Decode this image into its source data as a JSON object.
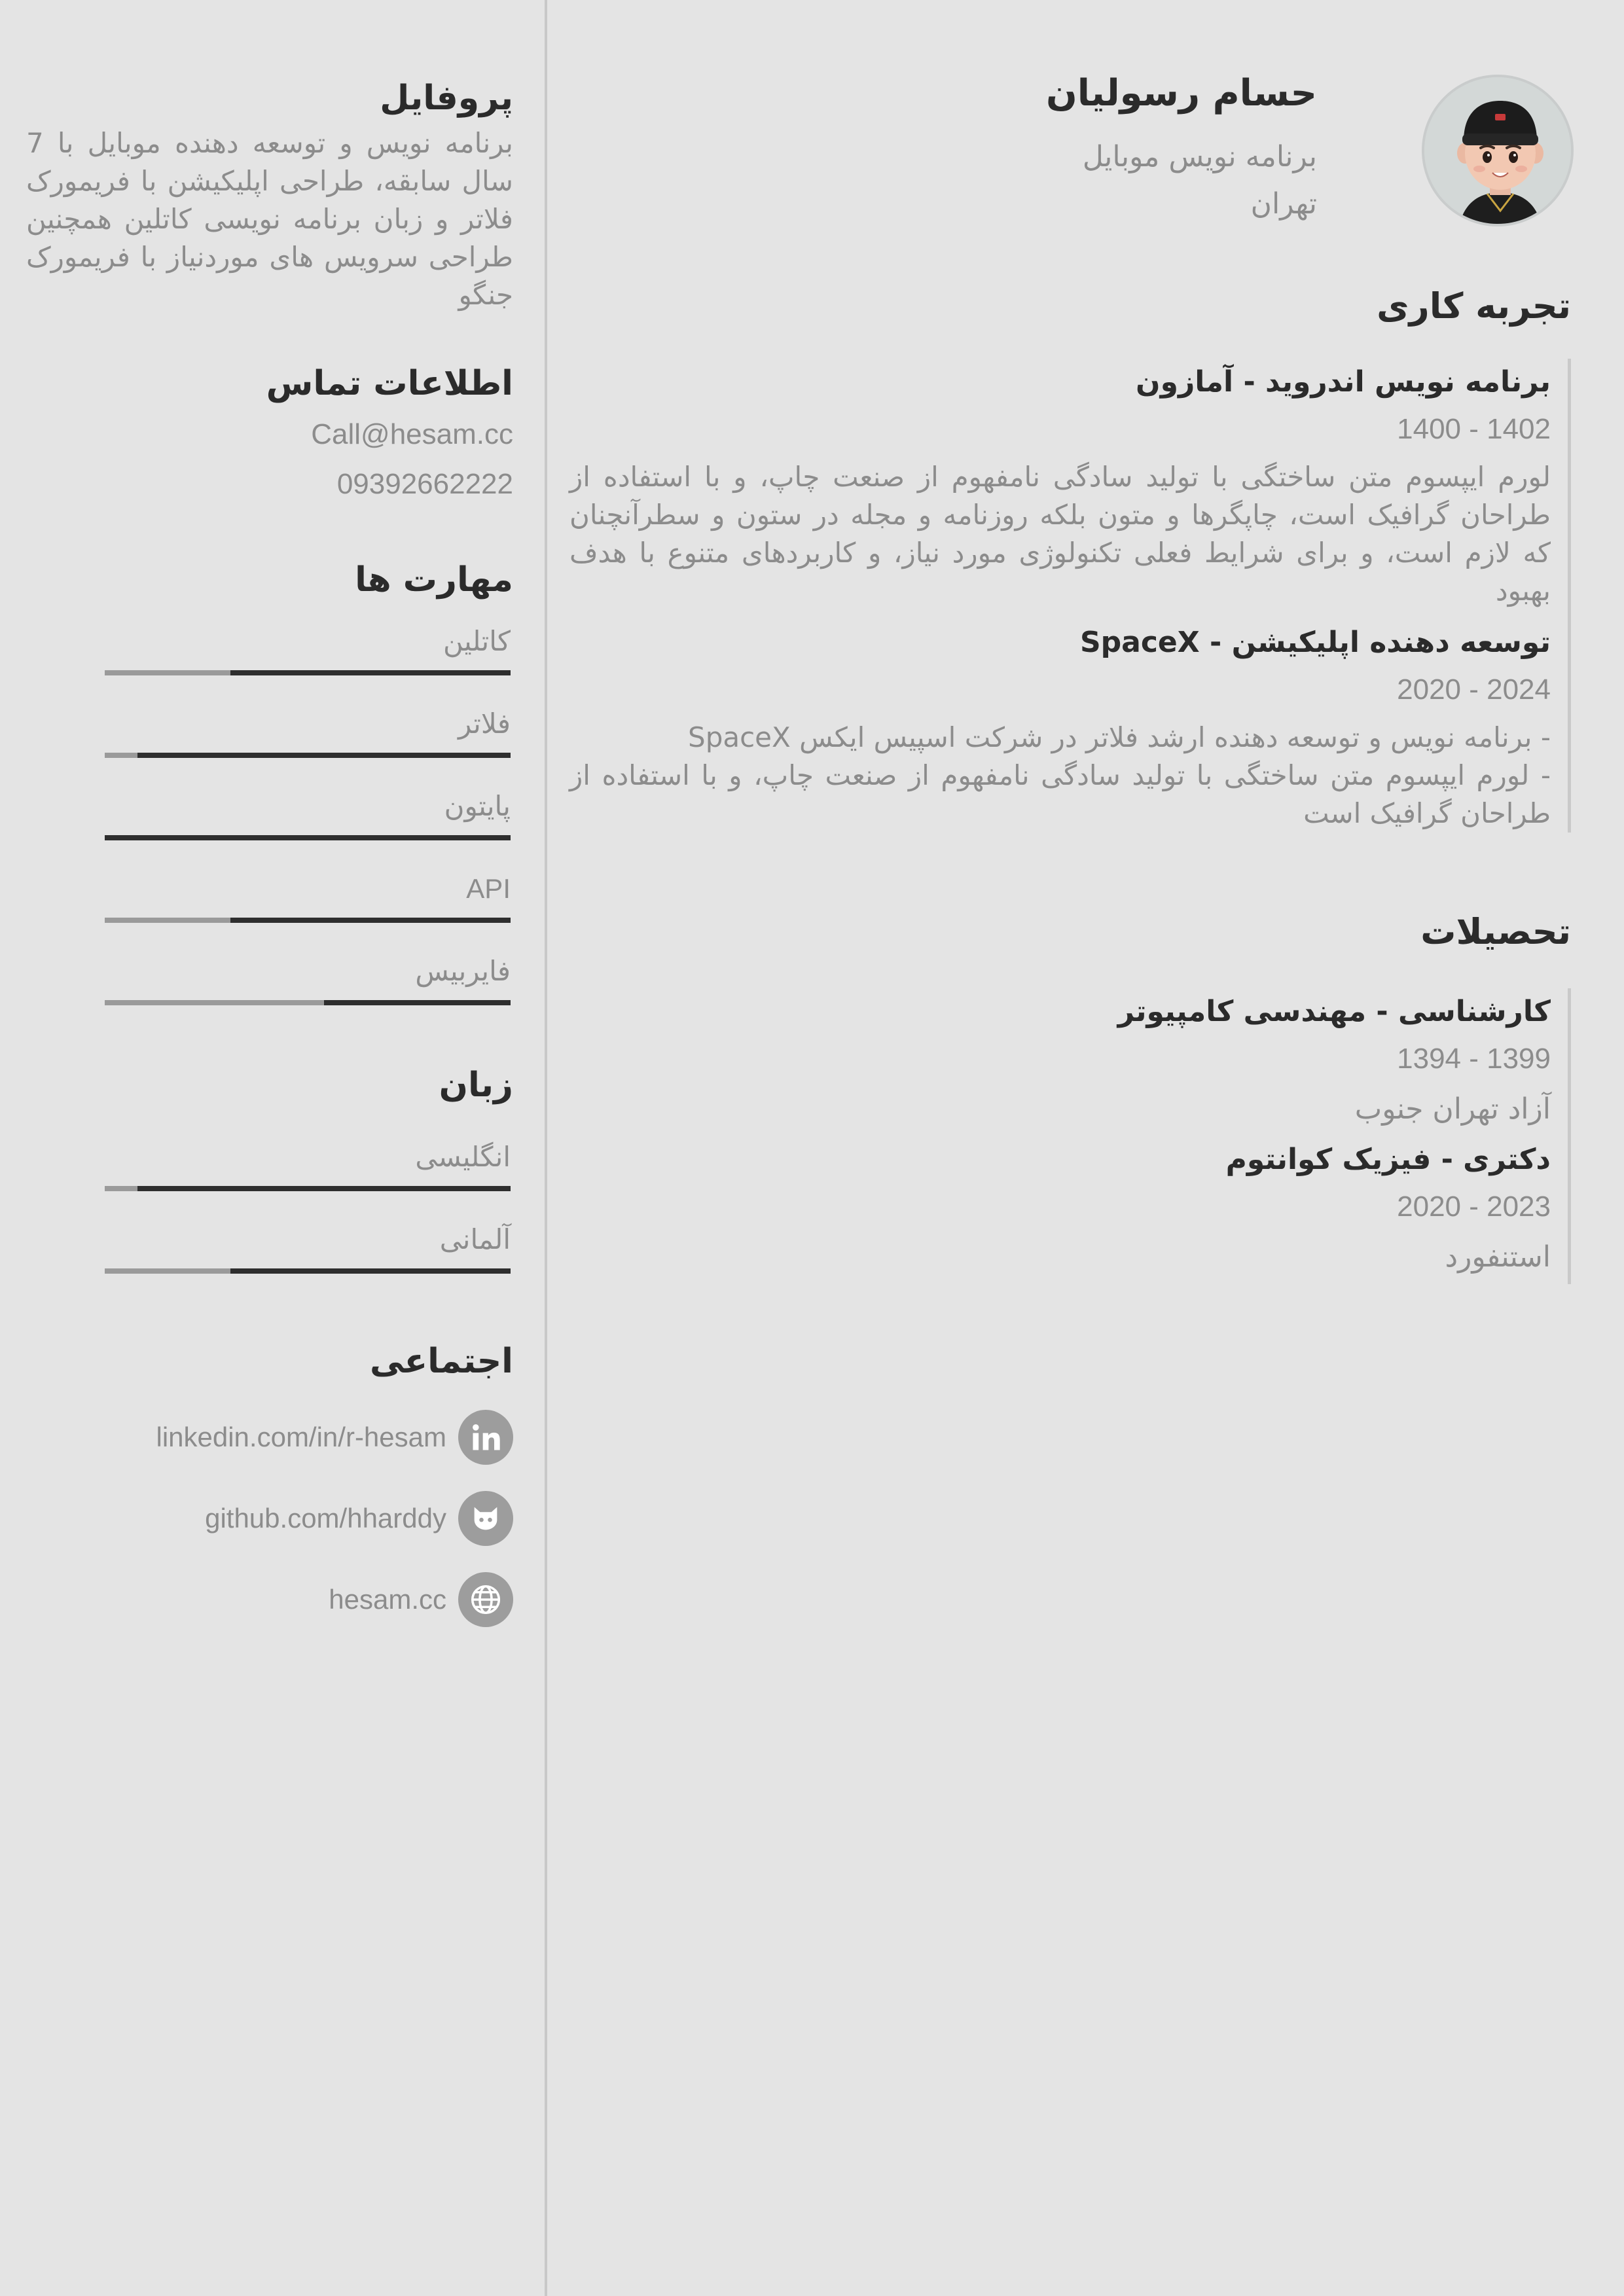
{
  "header": {
    "name": "حسام رسولیان",
    "job_title": "برنامه نویس موبایل",
    "city": "تهران"
  },
  "profile": {
    "heading": "پروفایل",
    "text": "برنامه نویس و توسعه دهنده موبایل با 7 سال سابقه، طراحی اپلیکیشن با فریمورک فلاتر و زبان برنامه نویسی کاتلین همچنین طراحی سرویس های موردنیاز با فریمورک جنگو"
  },
  "contact": {
    "heading": "اطلاعات تماس",
    "email": "Call@hesam.cc",
    "phone": "09392662222"
  },
  "skills": {
    "heading": "مهارت ها",
    "items": [
      {
        "label": "کاتلین",
        "level": 0.69
      },
      {
        "label": "فلاتر",
        "level": 0.92
      },
      {
        "label": "پایتون",
        "level": 1.0
      },
      {
        "label": "API",
        "level": 0.69
      },
      {
        "label": "فایربیس",
        "level": 0.46
      }
    ]
  },
  "languages": {
    "heading": "زبان",
    "items": [
      {
        "label": "انگلیسی",
        "level": 0.92
      },
      {
        "label": "آلمانی",
        "level": 0.69
      }
    ]
  },
  "social": {
    "heading": "اجتماعی",
    "items": [
      {
        "icon": "linkedin-icon",
        "text": "linkedin.com/in/r-hesam"
      },
      {
        "icon": "github-icon",
        "text": "github.com/hharddy"
      },
      {
        "icon": "globe-icon",
        "text": "hesam.cc"
      }
    ]
  },
  "experience": {
    "heading": "تجربه کاری",
    "items": [
      {
        "title": "برنامه نویس اندروید - آمازون",
        "date": "1400 - 1402",
        "desc": "لورم ایپسوم متن ساختگی با تولید سادگی نامفهوم از صنعت چاپ، و با استفاده از طراحان گرافیک است، چاپگرها و متون بلکه روزنامه و مجله در ستون و سطرآنچنان که لازم است، و برای شرایط فعلی تکنولوژی مورد نیاز، و کاربردهای متنوع با هدف بهبود"
      },
      {
        "title": "توسعه دهنده اپلیکیشن - SpaceX",
        "date": "2020 - 2024",
        "desc": "- برنامه نویس و توسعه دهنده ارشد فلاتر در شرکت اسپیس ایکس SpaceX\n- لورم ایپسوم متن ساختگی با تولید سادگی نامفهوم از صنعت چاپ، و با استفاده از طراحان گرافیک است"
      }
    ]
  },
  "education": {
    "heading": "تحصیلات",
    "items": [
      {
        "title": "کارشناسی - مهندسی کامپیوتر",
        "date": "1394 - 1399",
        "school": "آزاد تهران جنوب"
      },
      {
        "title": "دکتری - فیزیک کوانتوم",
        "date": "2020 - 2023",
        "school": "استنفورد"
      }
    ]
  },
  "colors": {
    "background": "#e4e4e4",
    "heading": "#2b2b2b",
    "text_muted": "#8c8c8c",
    "bar_fill": "#2e2e2e",
    "bar_track": "#9a9a9a"
  }
}
